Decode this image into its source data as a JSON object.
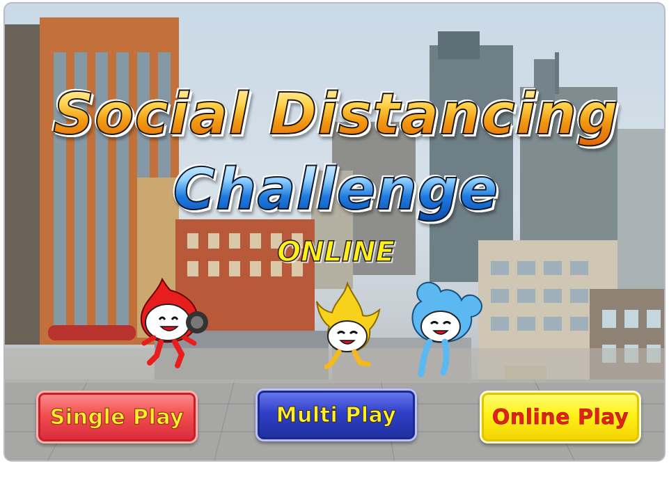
{
  "game": {
    "title_line1": "Social Distancing",
    "title_line2": "Challenge",
    "title_line3": "ONLINE"
  },
  "menu": {
    "single_play": "Single Play",
    "multi_play": "Multi Play",
    "online_play": "Online Play"
  },
  "characters": [
    {
      "name": "red-character-icon",
      "color": "#e81e1e"
    },
    {
      "name": "yellow-character-icon",
      "color": "#f7d21c"
    },
    {
      "name": "blue-character-icon",
      "color": "#5cb8f0"
    }
  ],
  "colors": {
    "single_play_button": "#e8434a",
    "multi_play_button": "#2a3bbd",
    "online_play_button": "#fff21a"
  }
}
